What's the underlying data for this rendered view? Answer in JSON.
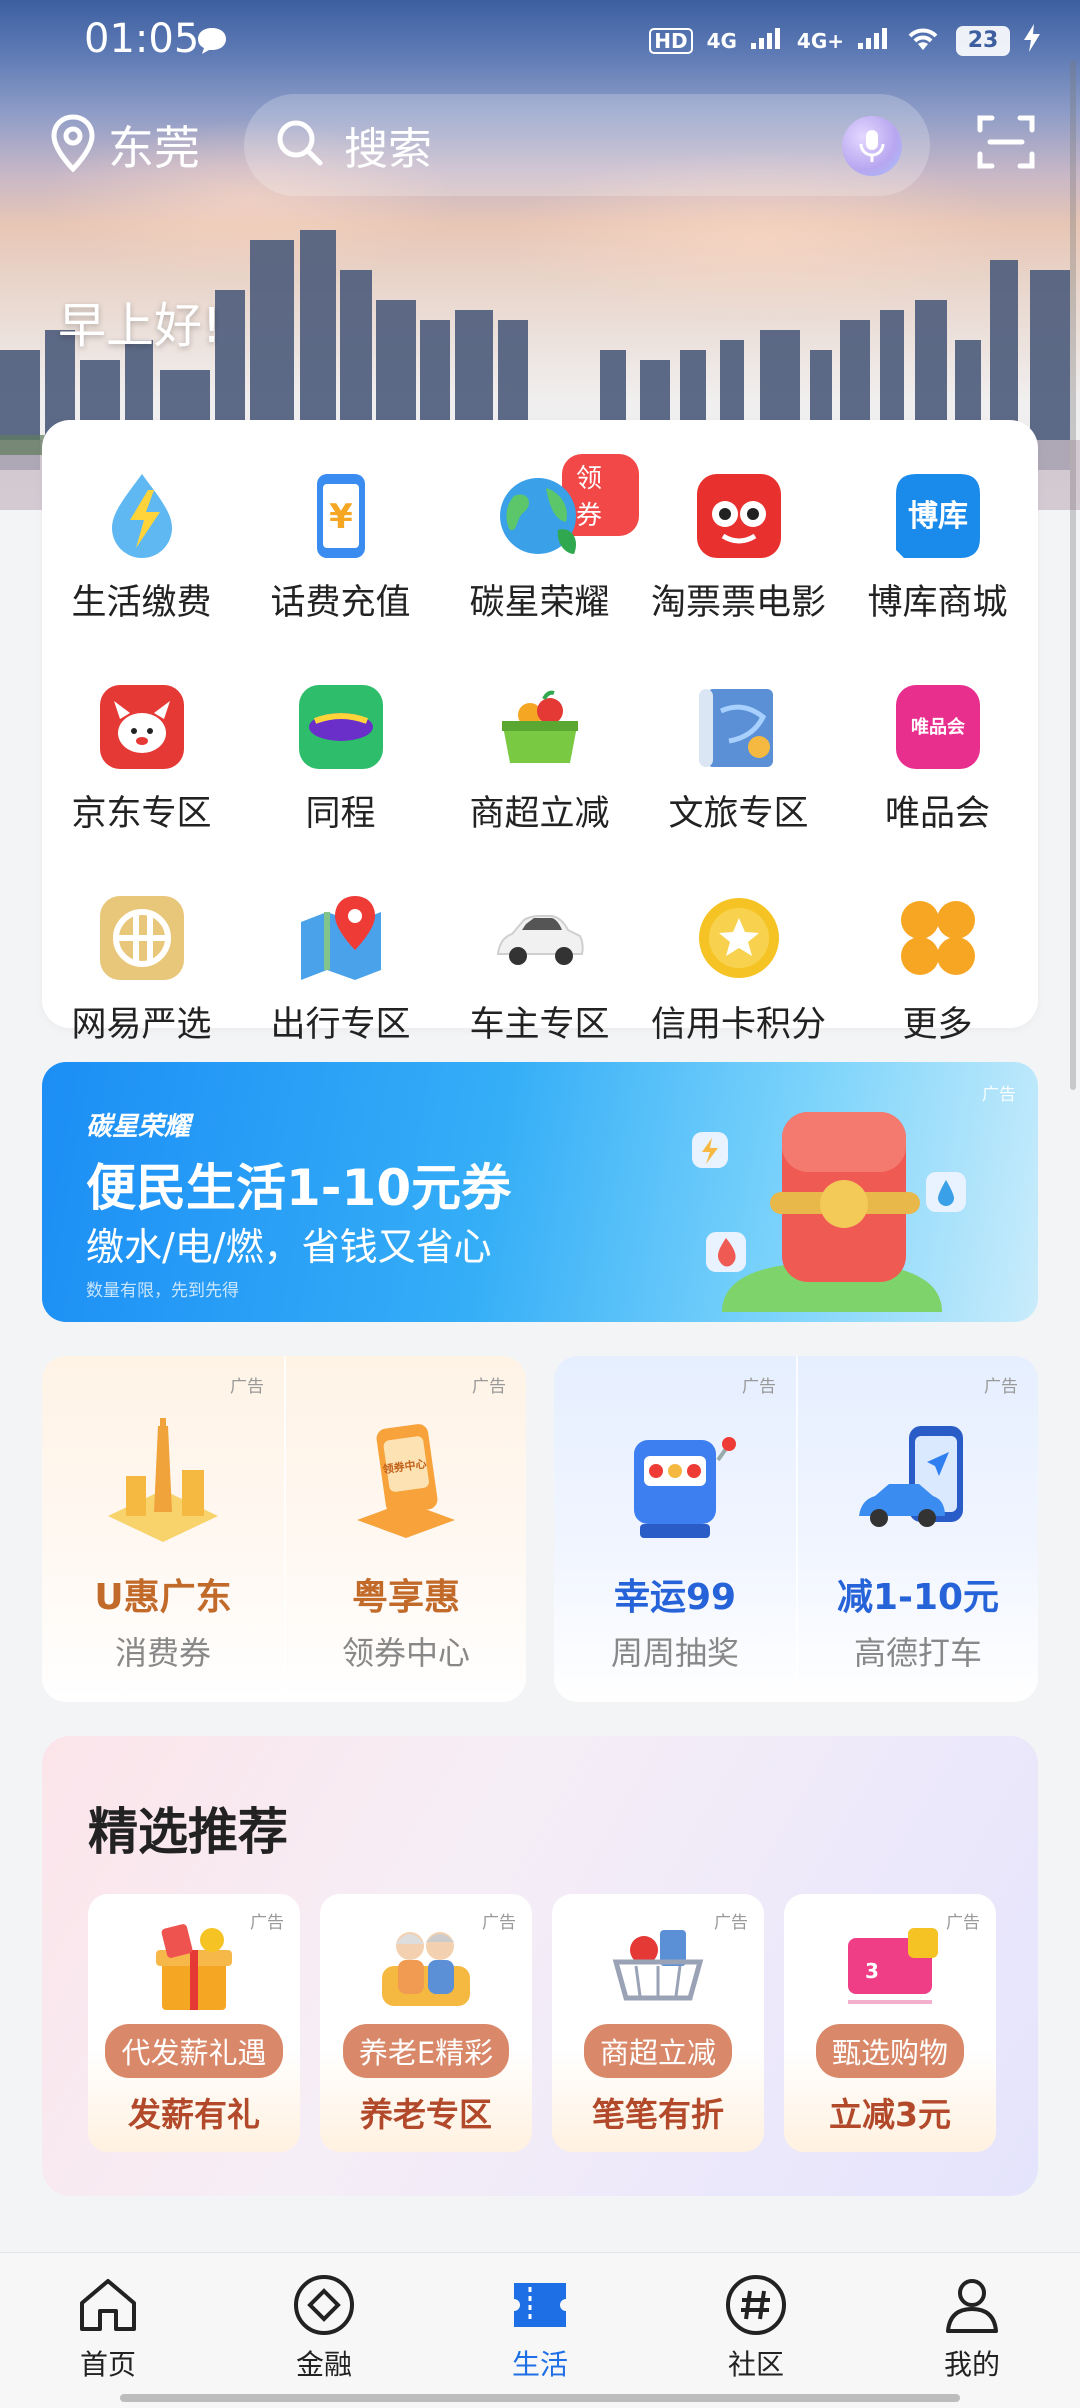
{
  "status_bar": {
    "time": "01:05",
    "hd": "HD",
    "network1": "4G",
    "network2": "4G+",
    "battery": "23"
  },
  "header": {
    "location": "东莞",
    "search_placeholder": "搜索",
    "greeting": "早上好!"
  },
  "services": [
    {
      "label": "生活缴费",
      "icon": "water-electric-icon"
    },
    {
      "label": "话费充值",
      "icon": "phone-recharge-icon"
    },
    {
      "label": "碳星荣耀",
      "icon": "earth-icon",
      "tag": "领券"
    },
    {
      "label": "淘票票电影",
      "icon": "taopiaopiao-icon"
    },
    {
      "label": "博库商城",
      "icon": "boku-icon"
    },
    {
      "label": "京东专区",
      "icon": "jd-icon"
    },
    {
      "label": "同程",
      "icon": "tongcheng-icon"
    },
    {
      "label": "商超立减",
      "icon": "basket-icon"
    },
    {
      "label": "文旅专区",
      "icon": "map-scroll-icon"
    },
    {
      "label": "唯品会",
      "icon": "vip-icon"
    },
    {
      "label": "网易严选",
      "icon": "yanxuan-icon"
    },
    {
      "label": "出行专区",
      "icon": "map-pin-icon"
    },
    {
      "label": "车主专区",
      "icon": "car-icon"
    },
    {
      "label": "信用卡积分",
      "icon": "star-coin-icon"
    },
    {
      "label": "更多",
      "icon": "more-icon"
    }
  ],
  "banner": {
    "brand": "碳星荣耀",
    "title": "便民生活1-10元券",
    "subtitle": "缴水/电/燃，省钱又省心",
    "note": "数量有限，先到先得",
    "ad": "广告"
  },
  "promos": {
    "ad": "广告",
    "items": [
      {
        "title": "U惠广东",
        "subtitle": "消费券"
      },
      {
        "title": "粤享惠",
        "subtitle": "领券中心"
      },
      {
        "title": "幸运99",
        "subtitle": "周周抽奖"
      },
      {
        "title": "减1-10元",
        "subtitle": "高德打车"
      }
    ]
  },
  "recommend": {
    "title": "精选推荐",
    "ad": "广告",
    "items": [
      {
        "chip": "代发薪礼遇",
        "text": "发薪有礼"
      },
      {
        "chip": "养老E精彩",
        "text": "养老专区"
      },
      {
        "chip": "商超立减",
        "text": "笔笔有折"
      },
      {
        "chip": "甄选购物",
        "text": "立减3元"
      }
    ]
  },
  "tabbar": [
    {
      "label": "首页",
      "icon": "home-icon"
    },
    {
      "label": "金融",
      "icon": "finance-icon"
    },
    {
      "label": "生活",
      "icon": "life-ticket-icon",
      "active": true
    },
    {
      "label": "社区",
      "icon": "hashtag-icon"
    },
    {
      "label": "我的",
      "icon": "profile-icon"
    }
  ],
  "colors": {
    "accent": "#1e6fe6",
    "coupon": "#f24848",
    "promo_orange": "#c26a2a",
    "promo_blue": "#2663d8"
  }
}
